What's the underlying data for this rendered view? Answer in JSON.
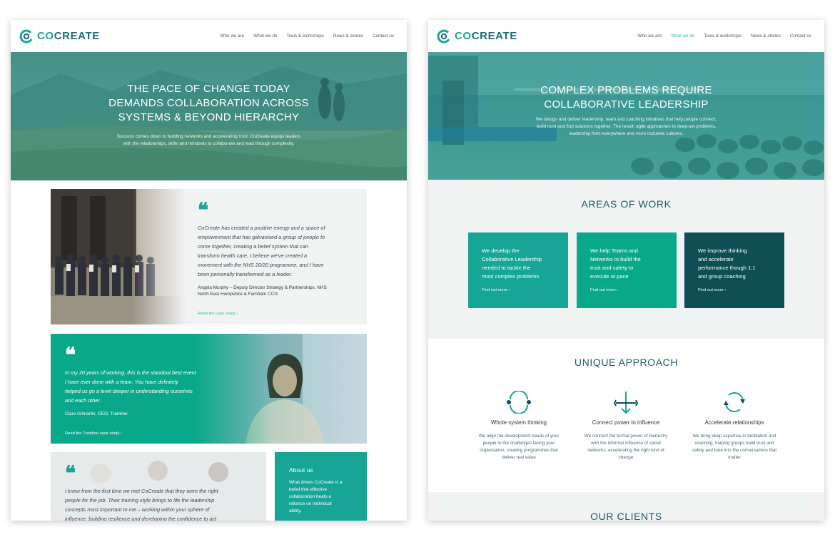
{
  "colors": {
    "teal": "#17a596",
    "green": "#0aa88a",
    "dark_teal": "#0d4f55",
    "brand": "#1f6b78",
    "accent": "#2ec1a2"
  },
  "brand": {
    "prefix": "CO",
    "suffix": "CREATE"
  },
  "nav": {
    "items": [
      "Who we are",
      "What we do",
      "Tools & workshops",
      "News & stories",
      "Contact us"
    ]
  },
  "left_page": {
    "hero": {
      "title_lines": [
        "THE PACE OF CHANGE TODAY",
        "DEMANDS COLLABORATION ACROSS",
        "SYSTEMS & BEYOND HIERARCHY"
      ],
      "subtitle_lines": [
        "Success comes down to building networks and accelerating trust. CoCreate equips leaders",
        "with the relationships, skills and mindsets to collaborate and lead through complexity."
      ]
    },
    "quote1": {
      "lines": [
        "CoCreate has created a positive energy and a space of",
        "empowerment that has galvanised a group of people to",
        "come together, creating a belief system that can",
        "transform health care. I believe we've created a",
        "movement with the NHS 20/20 programme, and I have",
        "been personally transformed as a leader."
      ],
      "name_lines": [
        "Angela Murphy – Deputy Director Strategy & Partnerships, NHS",
        "North East Hampshire & Farnham CCG"
      ],
      "link": "Read the case study"
    },
    "quote2": {
      "lines": [
        "In my 20 years of working, this is the standout best event",
        "I have ever done with a team. You have definitely",
        "helped us go a level deeper in understanding ourselves",
        "and each other."
      ],
      "name": "Clare Gilmartin, CEO, Trainline",
      "link": "Read the Trainline case study"
    },
    "quote3": {
      "lines": [
        "I knew from the first time we met CoCreate that they were the right",
        "people for the job. Their training style brings to life the leadership",
        "concepts most important to me – working within your sphere of",
        "influence, building resilience and developing the confidence to act"
      ]
    },
    "about": {
      "title": "About us",
      "lines": [
        "What drives CoCreate is a",
        "belief that effective",
        "collaboration beats a",
        "reliance on individual",
        "ability."
      ]
    }
  },
  "right_page": {
    "active_nav": "What we do",
    "hero": {
      "title_lines": [
        "COMPLEX PROBLEMS REQUIRE",
        "COLLABORATIVE LEADERSHIP"
      ],
      "subtitle_lines": [
        "We design and deliver leadership, team and coaching initiatives that help people connect,",
        "build trust and find solutions together. The result: agile approaches to deep-set problems,",
        "leadership from everywhere and more inclusive cultures."
      ]
    },
    "areas_title": "AREAS OF WORK",
    "areas": [
      {
        "lines": [
          "We develop the",
          "Collaborative Leadership",
          "needed to tackle the",
          "most complex problems"
        ],
        "link": "Find out more",
        "color": "#17a596"
      },
      {
        "lines": [
          "We help Teams and",
          "Networks to build the",
          "trust and safety to",
          "execute at pace"
        ],
        "link": "Find out more",
        "color": "#0aa88a"
      },
      {
        "lines": [
          "We improve thinking",
          "and accelerate",
          "performance though 1:1",
          "and group coaching"
        ],
        "link": "Find out more",
        "color": "#0d4f55"
      }
    ],
    "approach_title": "UNIQUE APPROACH",
    "approaches": [
      {
        "icon": "cycle-icon",
        "title": "Whole system thinking",
        "lines": [
          "We align the development needs of your",
          "people to the challenges facing your",
          "organisation, creating programmes that",
          "deliver real value"
        ]
      },
      {
        "icon": "connect-arrows-icon",
        "title": "Connect power to influence",
        "lines": [
          "We connect the formal power of hierarchy",
          "with the informal influence of social",
          "networks, accelerating the right kind of",
          "change"
        ]
      },
      {
        "icon": "spin-arrows-icon",
        "title": "Accelerate relationships",
        "lines": [
          "We bring deep expertise in facilitation and",
          "coaching, helping groups build trust and",
          "safety and tune into the conversations that",
          "matter"
        ]
      }
    ],
    "clients_title": "OUR CLIENTS"
  }
}
